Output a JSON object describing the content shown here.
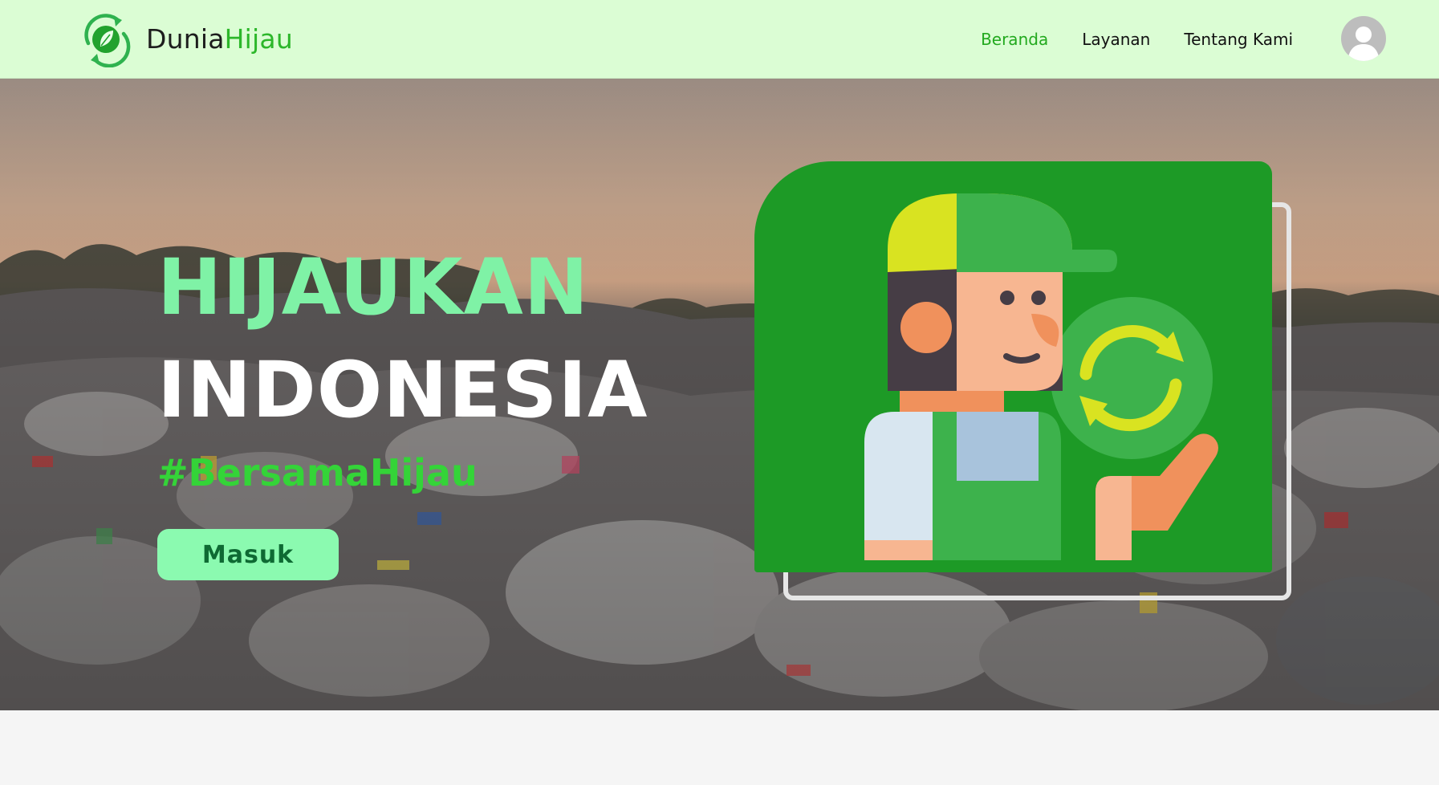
{
  "nav": {
    "brand_main": "Dunia",
    "brand_accent": "Hijau",
    "logo_icon": "recycle-leaf-icon",
    "links": [
      {
        "label": "Beranda",
        "active": true
      },
      {
        "label": "Layanan",
        "active": false
      },
      {
        "label": "Tentang Kami",
        "active": false
      }
    ],
    "avatar_icon": "user-avatar-icon"
  },
  "hero": {
    "title_line1": "HIJAUKAN",
    "title_line2": "INDONESIA",
    "hashtag": "#BersamaHijau",
    "cta_label": "Masuk",
    "illustration_icon": "recycling-worker-icon"
  },
  "colors": {
    "navbar_bg": "#dbfdd4",
    "brand_green": "#2cb72a",
    "active_link": "#22a91e",
    "title_accent": "#7ff2a6",
    "hashtag": "#34d438",
    "button_bg": "#8bfab0",
    "button_text": "#0e6a33",
    "card_green": "#1d9a26"
  }
}
